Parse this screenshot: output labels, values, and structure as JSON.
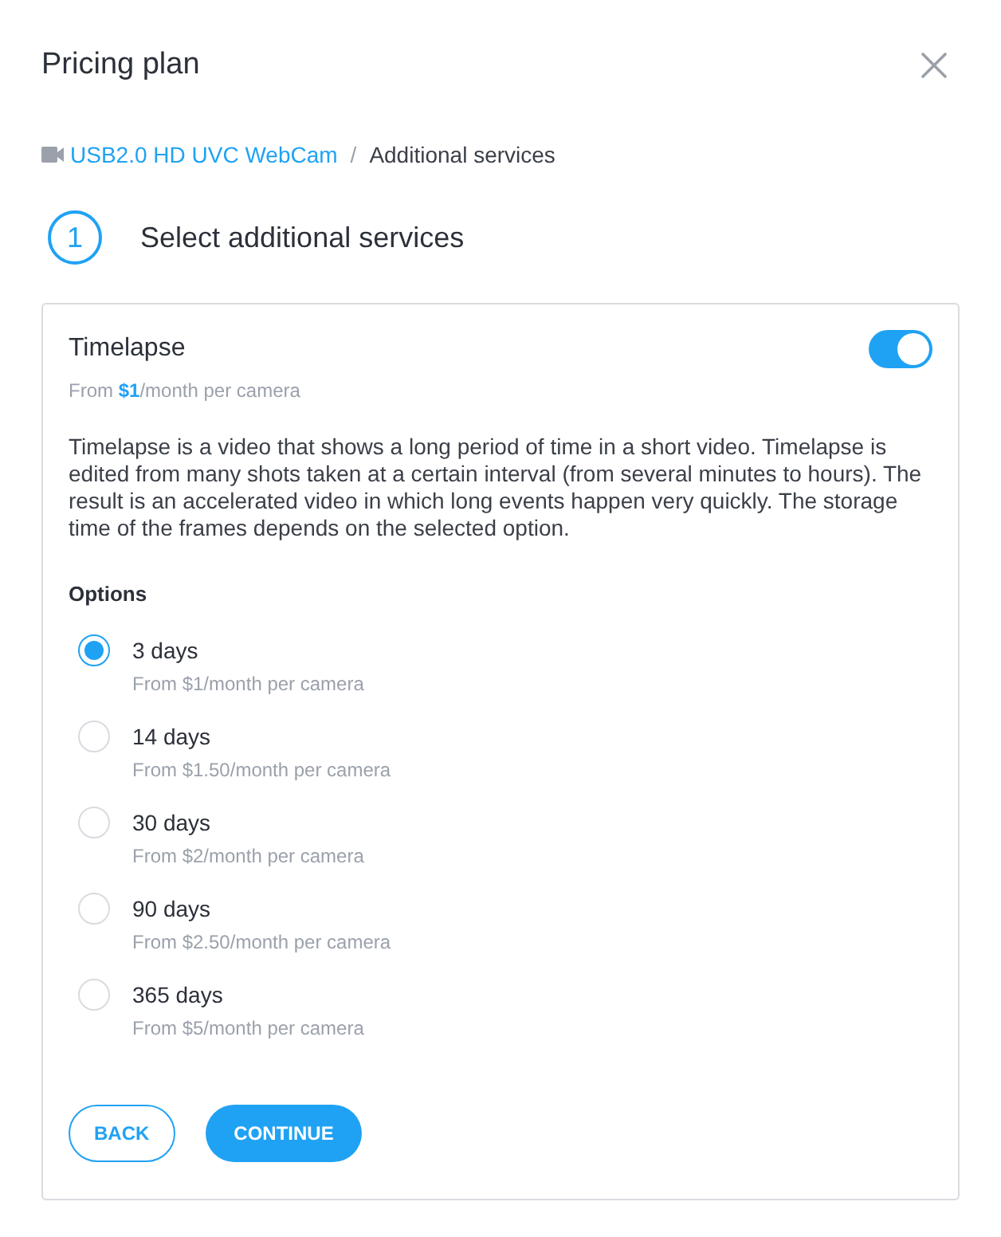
{
  "dialog": {
    "title": "Pricing plan"
  },
  "breadcrumb": {
    "separator": "/",
    "items": [
      {
        "label": "USB2.0 HD UVC WebCam",
        "kind": "link"
      },
      {
        "label": "Additional services",
        "kind": "current"
      }
    ]
  },
  "step": {
    "number": "1",
    "title": "Select additional services"
  },
  "service": {
    "name": "Timelapse",
    "enabled": true,
    "price": "From **$1**/month per camera",
    "description": "Timelapse is a video that shows a long period of time in a short video. Timelapse is edited from many shots taken at a certain interval (from several minutes to hours). The result is an accelerated video in which long events happen very quickly. The storage time of the frames depends on the selected option.",
    "options_label": "Options",
    "options": [
      {
        "label": "3 days",
        "price": "From $1/month per camera",
        "selected": true
      },
      {
        "label": "14 days",
        "price": "From $1.50/month per camera",
        "selected": false
      },
      {
        "label": "30 days",
        "price": "From $2/month per camera",
        "selected": false
      },
      {
        "label": "90 days",
        "price": "From $2.50/month per camera",
        "selected": false
      },
      {
        "label": "365 days",
        "price": "From $5/month per camera",
        "selected": false
      }
    ]
  },
  "buttons": [
    {
      "label": "BACK",
      "kind": "secondary"
    },
    {
      "label": "CONTINUE",
      "kind": "primary"
    }
  ]
}
